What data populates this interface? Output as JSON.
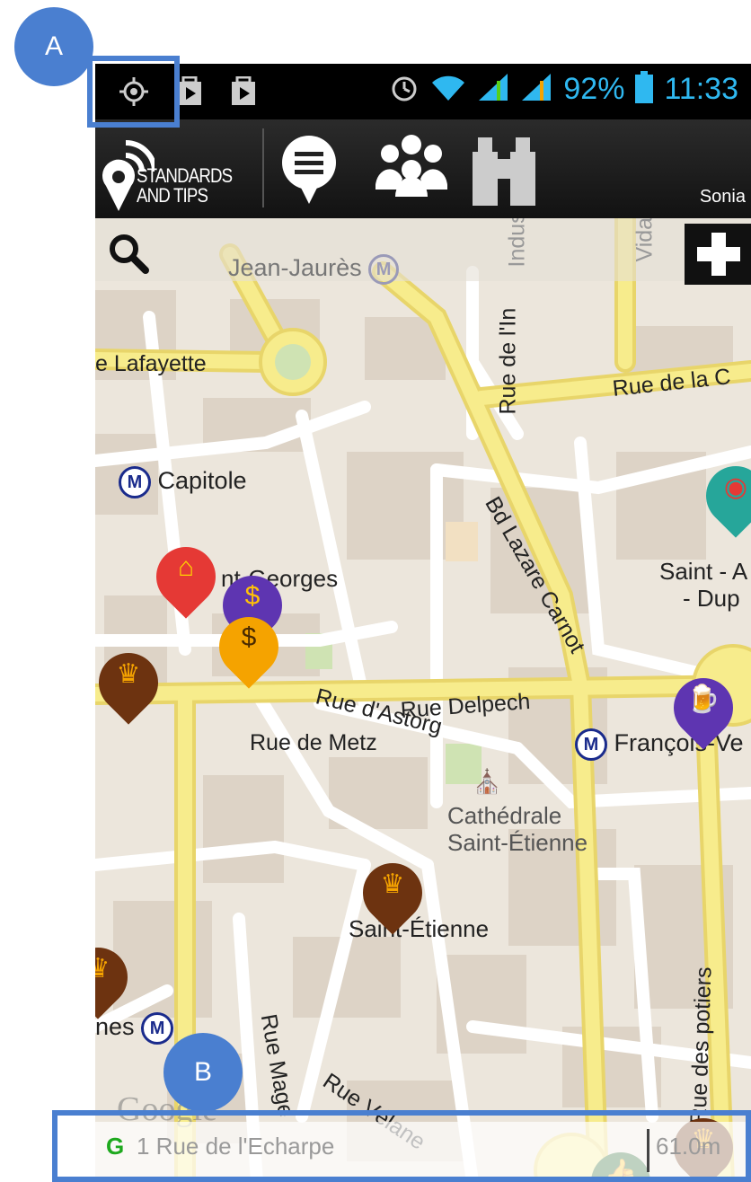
{
  "callouts": {
    "a": "A",
    "b": "B"
  },
  "status_bar": {
    "battery_pct": "92%",
    "time": "11:33",
    "icons": [
      "location-icon",
      "media-icon",
      "bag-icon",
      "alarm-icon",
      "wifi-icon",
      "signal-icon",
      "signal-icon-2",
      "battery-icon"
    ]
  },
  "app_bar": {
    "logo_line1": "STANDARDS",
    "logo_line2": "AND TIPS",
    "nav_icons": [
      "chat-icon",
      "community-icon",
      "binoculars-icon"
    ],
    "user": "Sonia"
  },
  "map": {
    "metro": [
      {
        "label": "Jean-Jaurès"
      },
      {
        "label": "Capitole"
      },
      {
        "label": "François-Ve"
      },
      {
        "label": "nes"
      }
    ],
    "places": {
      "georges": "nt-Georges",
      "saint_a": "Saint - A",
      "dup": "- Dup",
      "cathedrale_1": "Cathédrale",
      "cathedrale_2": "Saint-Étienne",
      "st_etienne": "Saint-Étienne"
    },
    "roads": {
      "lafayette": "e Lafayette",
      "rue_de_la_c": "Rue de la C",
      "rue_delpech": "Rue Delpech",
      "rue_dastorg": "Rue d'Astorg",
      "rue_de_metz": "Rue de Metz",
      "bd_lazare": "Bd Lazare Carnot",
      "rue_de_lin": "Rue de l'In",
      "rue_mage": "Rue Mage",
      "rue_velane": "Rue Vélane",
      "rue_des_potiers": "Rue des potiers",
      "industrie": "Industri",
      "vidal": "Vidal"
    },
    "watermark": "Google"
  },
  "bottom_bar": {
    "g_badge": "G",
    "address": "1 Rue de l'Echarpe",
    "distance": "61.0m"
  },
  "colors": {
    "accent": "#4a7fd0",
    "road": "#f7ec8c",
    "block": "#ddd3c6",
    "metro": "#1a2b8c"
  }
}
